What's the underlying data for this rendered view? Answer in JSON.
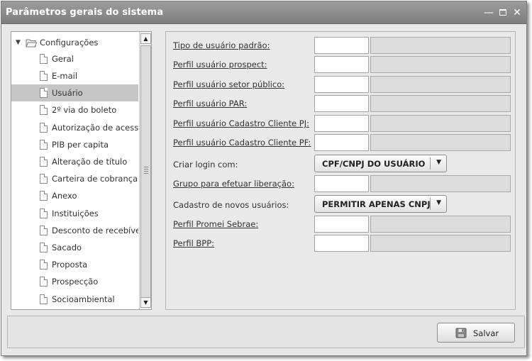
{
  "window": {
    "title": "Parâmetros gerais do sistema"
  },
  "tree": {
    "root_label": "Configurações",
    "items": [
      {
        "label": "Geral"
      },
      {
        "label": "E-mail"
      },
      {
        "label": "Usuário",
        "selected": true
      },
      {
        "label": "2º via do boleto"
      },
      {
        "label": "Autorização de acesso"
      },
      {
        "label": "PIB per capita"
      },
      {
        "label": "Alteração de título"
      },
      {
        "label": "Carteira de cobrança"
      },
      {
        "label": "Anexo"
      },
      {
        "label": "Instituições"
      },
      {
        "label": "Desconto de recebíveis"
      },
      {
        "label": "Sacado"
      },
      {
        "label": "Proposta"
      },
      {
        "label": "Prospecção"
      },
      {
        "label": "Socioambiental"
      }
    ]
  },
  "form": {
    "tipo_usuario_padrao": {
      "label": "Tipo de usuário padrão:",
      "code": "",
      "description": ""
    },
    "perfil_usuario_prospect": {
      "label": "Perfil usuário prospect:",
      "code": "",
      "description": ""
    },
    "perfil_usuario_setor_publico": {
      "label": "Perfil usuário setor público:",
      "code": "",
      "description": ""
    },
    "perfil_usuario_par": {
      "label": "Perfil usuário PAR:",
      "code": "",
      "description": ""
    },
    "perfil_usuario_cadastro_pj": {
      "label": "Perfil usuário Cadastro Cliente PJ:",
      "code": "",
      "description": ""
    },
    "perfil_usuario_cadastro_pf": {
      "label": "Perfil usuário Cadastro Cliente PF:",
      "code": "",
      "description": ""
    },
    "criar_login": {
      "label": "Criar login com:",
      "value": "CPF/CNPJ DO USUÁRIO"
    },
    "grupo_liberacao": {
      "label": "Grupo para efetuar liberação:",
      "code": "",
      "description": ""
    },
    "cadastro_novos_usuarios": {
      "label": "Cadastro de novos usuários:",
      "value": "PERMITIR APENAS CNPJ"
    },
    "perfil_promei_sebrae": {
      "label": "Perfil Promei Sebrae:",
      "code": "",
      "description": ""
    },
    "perfil_bpp": {
      "label": "Perfil BPP:",
      "code": "",
      "description": ""
    }
  },
  "footer": {
    "save_label": "Salvar"
  }
}
